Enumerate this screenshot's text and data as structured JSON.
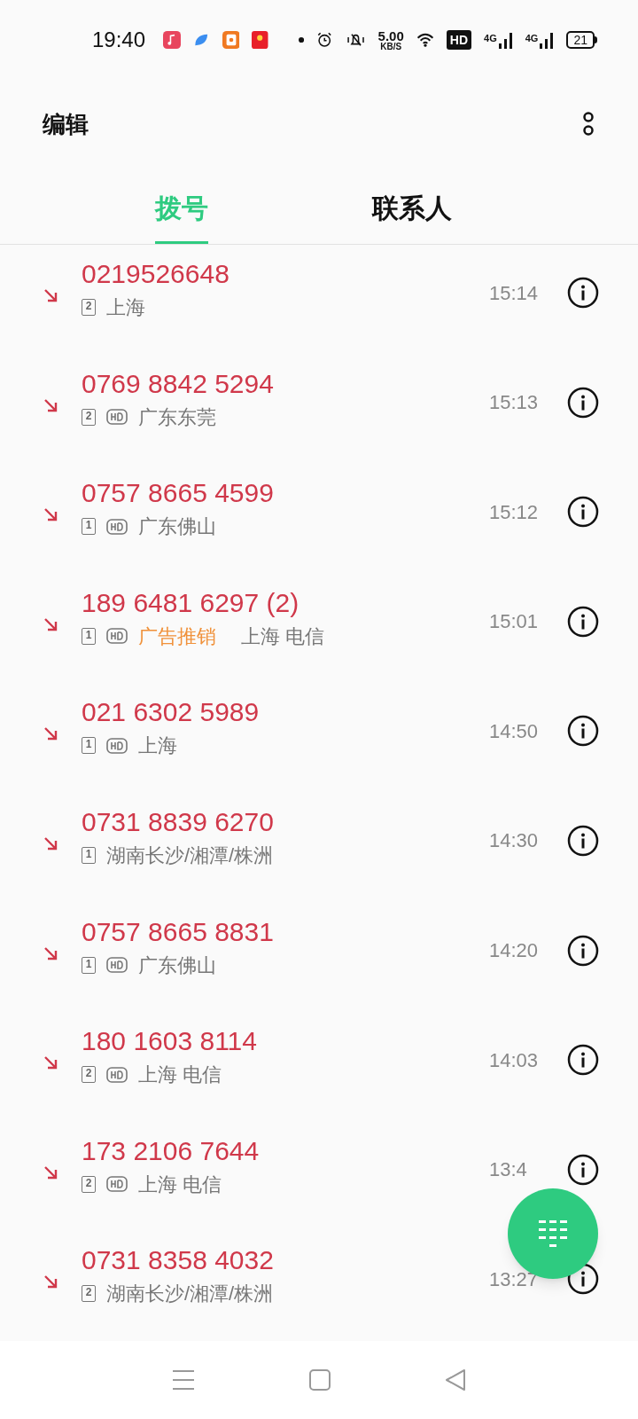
{
  "status_bar": {
    "time": "19:40",
    "speed_value": "5.00",
    "speed_unit": "KB/S",
    "hd_label": "HD",
    "signals": [
      "4G",
      "4G"
    ],
    "battery": "21"
  },
  "header": {
    "title": "编辑"
  },
  "tabs": [
    {
      "label": "拨号",
      "selected": true
    },
    {
      "label": "联系人",
      "selected": false
    }
  ],
  "calls": [
    {
      "number": "0219526648",
      "sim": "2",
      "hd": false,
      "location": "上海",
      "time": "15:14"
    },
    {
      "number": "0769 8842 5294",
      "sim": "2",
      "hd": true,
      "location": "广东东莞",
      "time": "15:13"
    },
    {
      "number": "0757 8665 4599",
      "sim": "1",
      "hd": true,
      "location": "广东佛山",
      "time": "15:12"
    },
    {
      "number": "189 6481 6297 (2)",
      "sim": "1",
      "hd": true,
      "tag": "广告推销",
      "location": "上海 电信",
      "time": "15:01"
    },
    {
      "number": "021 6302 5989",
      "sim": "1",
      "hd": true,
      "location": "上海",
      "time": "14:50"
    },
    {
      "number": "0731 8839 6270",
      "sim": "1",
      "hd": false,
      "location": "湖南长沙/湘潭/株洲",
      "time": "14:30"
    },
    {
      "number": "0757 8665 8831",
      "sim": "1",
      "hd": true,
      "location": "广东佛山",
      "time": "14:20"
    },
    {
      "number": "180 1603 8114",
      "sim": "2",
      "hd": true,
      "location": "上海 电信",
      "time": "14:03"
    },
    {
      "number": "173 2106 7644",
      "sim": "2",
      "hd": true,
      "location": "上海 电信",
      "time": "13:4"
    },
    {
      "number": "0731 8358 4032",
      "sim": "2",
      "hd": false,
      "location": "湖南长沙/湘潭/株洲",
      "time": "13:27"
    }
  ]
}
